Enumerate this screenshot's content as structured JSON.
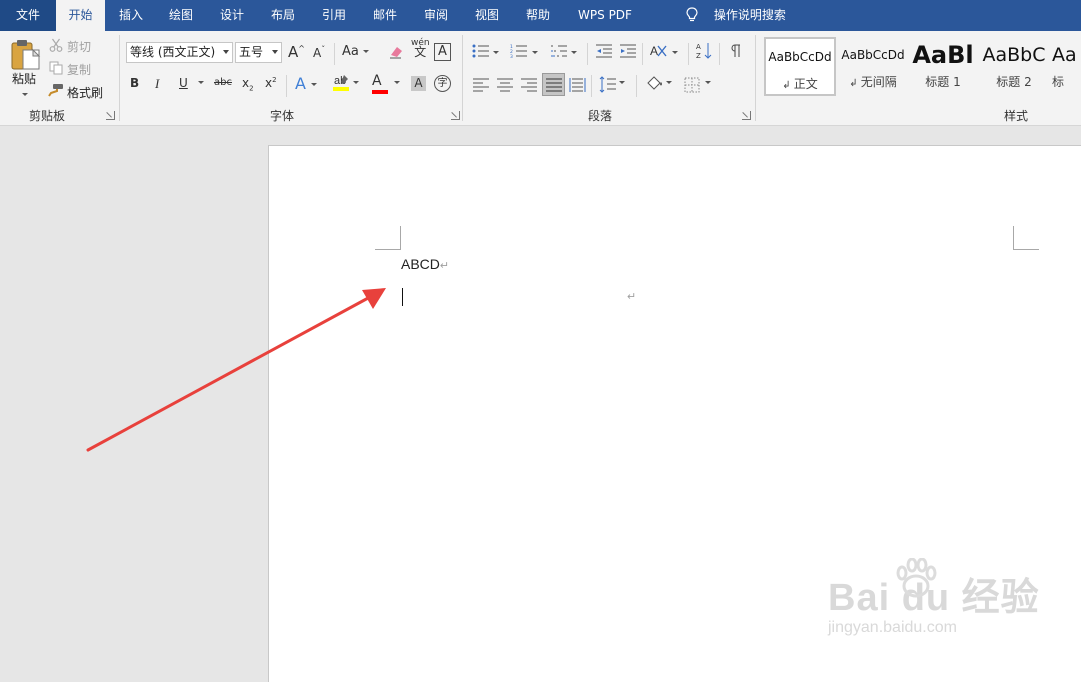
{
  "tabs": {
    "file": "文件",
    "items": [
      "开始",
      "插入",
      "绘图",
      "设计",
      "布局",
      "引用",
      "邮件",
      "审阅",
      "视图",
      "帮助",
      "WPS PDF"
    ],
    "active_index": 0,
    "tell_me": "操作说明搜索"
  },
  "clipboard": {
    "paste": "粘贴",
    "cut": "剪切",
    "copy": "复制",
    "format_painter": "格式刷",
    "label": "剪贴板"
  },
  "font": {
    "name": "等线 (西文正文)",
    "size": "五号",
    "grow": "A",
    "shrink": "A",
    "case": "Aa",
    "phonetic": "wén",
    "bold": "B",
    "italic": "I",
    "underline": "U",
    "strike": "abc",
    "subscript": "x",
    "superscript": "x",
    "text_effect": "A",
    "font_color": "A",
    "shading": "A",
    "enclose": "字",
    "label": "字体",
    "highlight_color": "#ffff00",
    "font_color_value": "#ff0000"
  },
  "paragraph": {
    "label": "段落"
  },
  "styles": {
    "label": "样式",
    "items": [
      {
        "sample": "AaBbCcDd",
        "name": "正文",
        "selected": true
      },
      {
        "sample": "AaBbCcDd",
        "name": "无间隔",
        "selected": false
      },
      {
        "sample": "AaBl",
        "name": "标题 1",
        "selected": false
      },
      {
        "sample": "AaBbC",
        "name": "标题 2",
        "selected": false
      },
      {
        "sample": "Aa",
        "name": "标",
        "selected": false
      }
    ]
  },
  "document": {
    "line1": "ABCD",
    "paragraph_mark": "↵"
  },
  "watermark": {
    "brand": "Bai du 经验",
    "url": "jingyan.baidu.com"
  },
  "colors": {
    "accent": "#2b579a",
    "arrow": "#e8413c"
  }
}
